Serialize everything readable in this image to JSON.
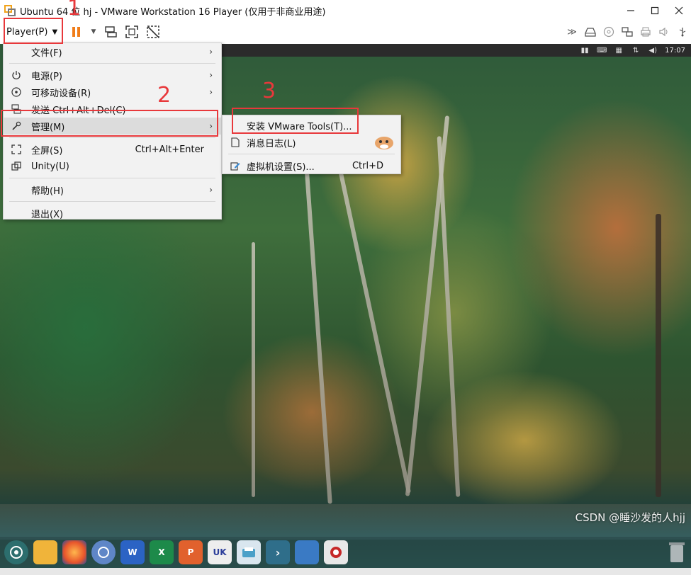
{
  "window": {
    "title": "Ubuntu 64 位 hj - VMware Workstation 16 Player (仅用于非商业用途)",
    "controls": [
      "minimize",
      "maximize",
      "close"
    ]
  },
  "toolbar": {
    "player_label": "Player(P)",
    "left_icons": [
      "pause-icon",
      "send-ctrl-alt-del-icon",
      "fullscreen-icon",
      "unity-icon"
    ],
    "right_icons": [
      "forward-icon",
      "hdd-icon",
      "cd-icon",
      "network-icon",
      "printer-icon",
      "sound-icon",
      "usb-icon"
    ]
  },
  "guest": {
    "clock": "17:07"
  },
  "player_menu": {
    "items": [
      {
        "label": "文件(F)",
        "shortcut": "",
        "has_submenu": true,
        "icon": ""
      },
      {
        "label": "电源(P)",
        "shortcut": "",
        "has_submenu": true,
        "icon": "power-icon"
      },
      {
        "label": "可移动设备(R)",
        "shortcut": "",
        "has_submenu": true,
        "icon": "removable-device-icon"
      },
      {
        "label": "发送 Ctrl+Alt+Del(C)",
        "shortcut": "",
        "has_submenu": false,
        "icon": "keyboard-icon"
      },
      {
        "label": "管理(M)",
        "shortcut": "",
        "has_submenu": true,
        "icon": "wrench-icon"
      },
      {
        "label": "全屏(S)",
        "shortcut": "Ctrl+Alt+Enter",
        "has_submenu": false,
        "icon": "fullscreen-icon"
      },
      {
        "label": "Unity(U)",
        "shortcut": "",
        "has_submenu": false,
        "icon": "unity-icon"
      },
      {
        "label": "帮助(H)",
        "shortcut": "",
        "has_submenu": true,
        "icon": ""
      },
      {
        "label": "退出(X)",
        "shortcut": "",
        "has_submenu": false,
        "icon": ""
      }
    ]
  },
  "manage_submenu": {
    "items": [
      {
        "label": "安装 VMware Tools(T)...",
        "shortcut": ""
      },
      {
        "label": "消息日志(L)",
        "shortcut": ""
      },
      {
        "label": "虚拟机设置(S)...",
        "shortcut": "Ctrl+D"
      }
    ]
  },
  "annotations": {
    "step1": "1",
    "step2": "2",
    "step3": "3",
    "color": "#e8383b"
  },
  "watermark": "CSDN @睡沙发的人hjj"
}
